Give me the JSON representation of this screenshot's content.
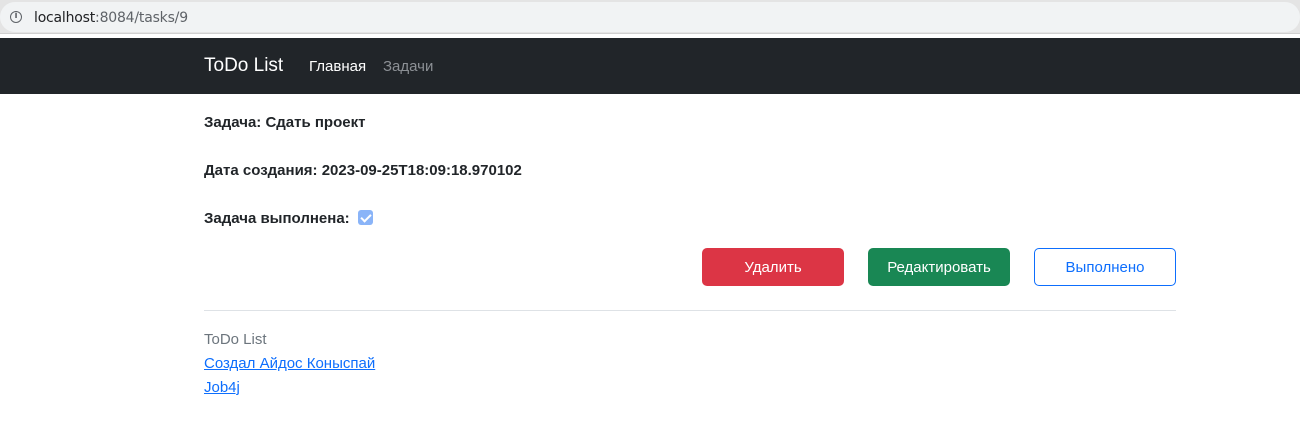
{
  "browser": {
    "url_host": "localhost",
    "url_path": ":8084/tasks/9",
    "info_icon": "info-icon"
  },
  "navbar": {
    "brand": "ToDo List",
    "links": [
      {
        "label": "Главная",
        "active": true
      },
      {
        "label": "Задачи",
        "active": false
      }
    ]
  },
  "task": {
    "title_line": "Задача: Сдать проект",
    "created_line": "Дата создания: 2023-09-25T18:09:18.970102",
    "done_label": "Задача выполнена:",
    "done_checked": true
  },
  "actions": {
    "delete_label": "Удалить",
    "edit_label": "Редактировать",
    "done_label": "Выполнено"
  },
  "footer": {
    "title": "ToDo List",
    "author_link": "Создал Айдос Коныспай",
    "job_link": "Job4j"
  },
  "colors": {
    "navbar_bg": "#212529",
    "danger": "#dc3545",
    "success": "#198754",
    "primary": "#0d6efd"
  }
}
